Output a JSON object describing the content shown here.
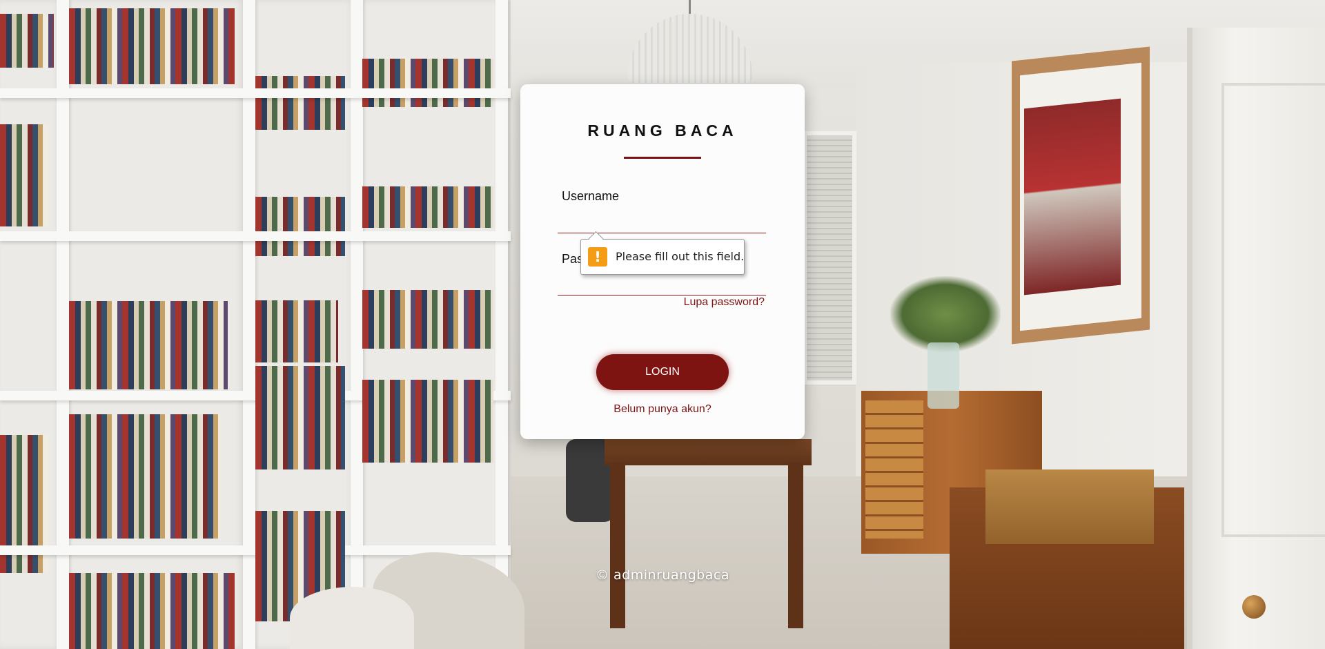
{
  "brand": {
    "title": "RUANG BACA"
  },
  "form": {
    "username_label": "Username",
    "username_value": "",
    "password_label": "Pas",
    "password_value": "",
    "forgot_link": "Lupa password?",
    "login_button": "LOGIN",
    "register_link": "Belum punya akun?"
  },
  "validation": {
    "icon": "warning-icon",
    "icon_glyph": "!",
    "message": "Please fill out this field."
  },
  "footer": {
    "copyright": "© adminruangbaca"
  },
  "colors": {
    "accent": "#7d1411",
    "warning": "#f49c16",
    "card": "#fdfcfc"
  }
}
